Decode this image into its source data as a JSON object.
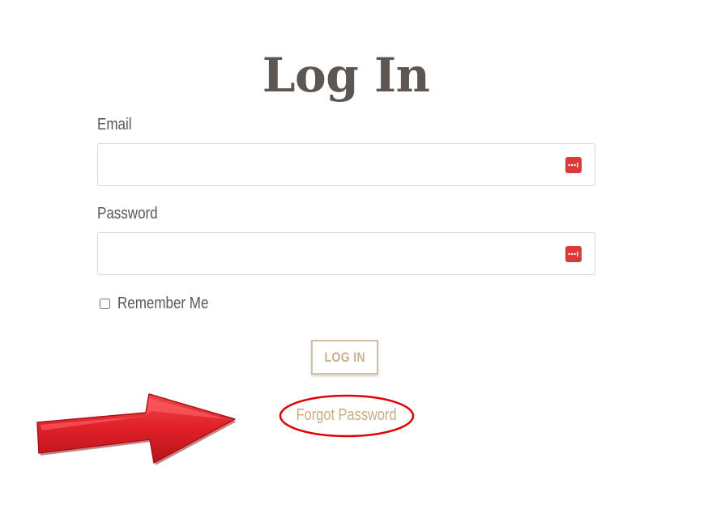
{
  "form": {
    "title": "Log In",
    "email": {
      "label": "Email",
      "value": "",
      "placeholder": ""
    },
    "password": {
      "label": "Password",
      "value": "",
      "placeholder": ""
    },
    "remember": {
      "label": "Remember Me",
      "checked": false
    },
    "submit_label": "LOG IN",
    "forgot_label": "Forgot Password"
  },
  "icons": {
    "field_icon": "password-manager-icon"
  },
  "annotation": {
    "arrow_color": "#e02028",
    "ellipse_color": "#e00000"
  },
  "colors": {
    "heading": "#5e5652",
    "accent": "#c8ac88",
    "field_icon_bg": "#d93a3a"
  }
}
